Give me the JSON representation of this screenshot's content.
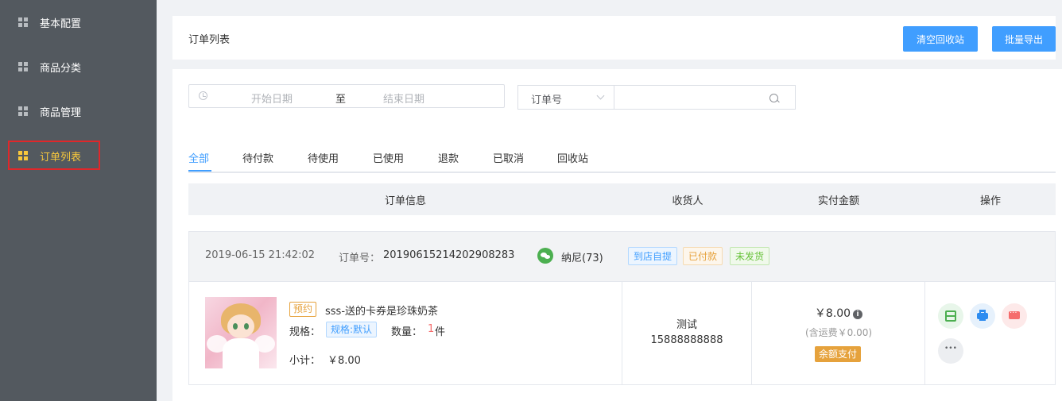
{
  "sidebar": {
    "items": [
      {
        "label": "基本配置",
        "active": false
      },
      {
        "label": "商品分类",
        "active": false
      },
      {
        "label": "商品管理",
        "active": false
      },
      {
        "label": "订单列表",
        "active": true
      }
    ]
  },
  "header": {
    "title": "订单列表",
    "buttons": {
      "clear_recycle": "清空回收站",
      "batch_export": "批量导出"
    }
  },
  "filters": {
    "start_date_placeholder": "开始日期",
    "separator": "至",
    "end_date_placeholder": "结束日期",
    "search_type": "订单号",
    "search_value": ""
  },
  "tabs": [
    {
      "label": "全部",
      "active": true
    },
    {
      "label": "待付款"
    },
    {
      "label": "待使用"
    },
    {
      "label": "已使用"
    },
    {
      "label": "退款"
    },
    {
      "label": "已取消"
    },
    {
      "label": "回收站"
    }
  ],
  "table": {
    "headers": [
      "订单信息",
      "收货人",
      "实付金额",
      "操作"
    ]
  },
  "order": {
    "time": "2019-06-15 21:42:02",
    "no_label": "订单号：",
    "no": "20190615214202908283",
    "user": "纳尼(73)",
    "tags": [
      "到店自提",
      "已付款",
      "未发货"
    ],
    "product": {
      "badge": "预约",
      "name": "sss-送的卡券是珍珠奶茶",
      "spec_label": "规格：",
      "spec": "规格:默认",
      "qty_label": "数量：",
      "qty": "1",
      "qty_unit": "件",
      "subtotal_label": "小计：",
      "subtotal": "￥8.00"
    },
    "receiver": {
      "name": "测试",
      "phone": "15888888888"
    },
    "payment": {
      "amount": "￥8.00",
      "shipping": "(含运费￥0.00)",
      "method": "余额支付"
    }
  },
  "colors": {
    "sidebar": "#53595f",
    "active": "#f8c83c",
    "primary": "#409eff"
  }
}
